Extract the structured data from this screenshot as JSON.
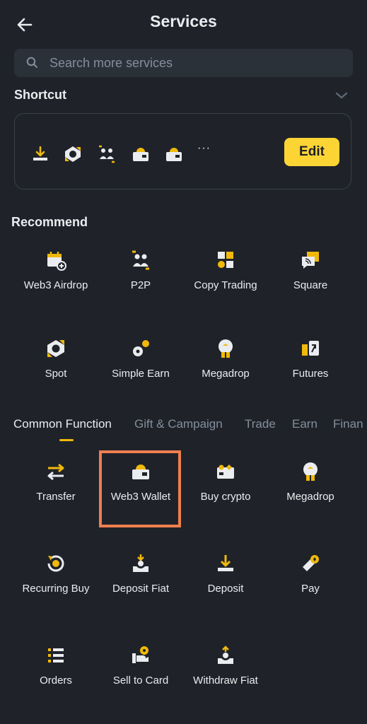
{
  "header": {
    "title": "Services"
  },
  "search": {
    "placeholder": "Search more services"
  },
  "shortcut": {
    "title": "Shortcut",
    "icons": [
      "download-icon",
      "spot-icon",
      "p2p-icon",
      "wallet-icon",
      "wallet-icon"
    ],
    "more": "···",
    "edit_label": "Edit"
  },
  "recommend": {
    "title": "Recommend",
    "items": [
      {
        "label": "Web3 Airdrop",
        "icon": "calendar-plus-icon"
      },
      {
        "label": "P2P",
        "icon": "p2p-icon"
      },
      {
        "label": "Copy Trading",
        "icon": "copy-trading-icon"
      },
      {
        "label": "Square",
        "icon": "square-icon"
      },
      {
        "label": "Spot",
        "icon": "spot-icon"
      },
      {
        "label": "Simple Earn",
        "icon": "simple-earn-icon"
      },
      {
        "label": "Megadrop",
        "icon": "megadrop-icon"
      },
      {
        "label": "Futures",
        "icon": "futures-icon"
      }
    ]
  },
  "tabs": [
    "Common Function",
    "Gift & Campaign",
    "Trade",
    "Earn",
    "Finan"
  ],
  "common": {
    "items": [
      {
        "label": "Transfer",
        "icon": "transfer-icon"
      },
      {
        "label": "Web3 Wallet",
        "icon": "wallet-icon"
      },
      {
        "label": "Buy crypto",
        "icon": "buy-crypto-icon"
      },
      {
        "label": "Megadrop",
        "icon": "megadrop-icon"
      },
      {
        "label": "Recurring Buy",
        "icon": "recurring-icon"
      },
      {
        "label": "Deposit Fiat",
        "icon": "deposit-fiat-icon"
      },
      {
        "label": "Deposit",
        "icon": "deposit-icon"
      },
      {
        "label": "Pay",
        "icon": "pay-icon"
      },
      {
        "label": "Orders",
        "icon": "orders-icon"
      },
      {
        "label": "Sell to Card",
        "icon": "sell-card-icon"
      },
      {
        "label": "Withdraw Fiat",
        "icon": "withdraw-fiat-icon"
      }
    ]
  },
  "colors": {
    "accent": "#f0b90b",
    "highlight": "#ee7f4f",
    "background": "#1f2329"
  }
}
